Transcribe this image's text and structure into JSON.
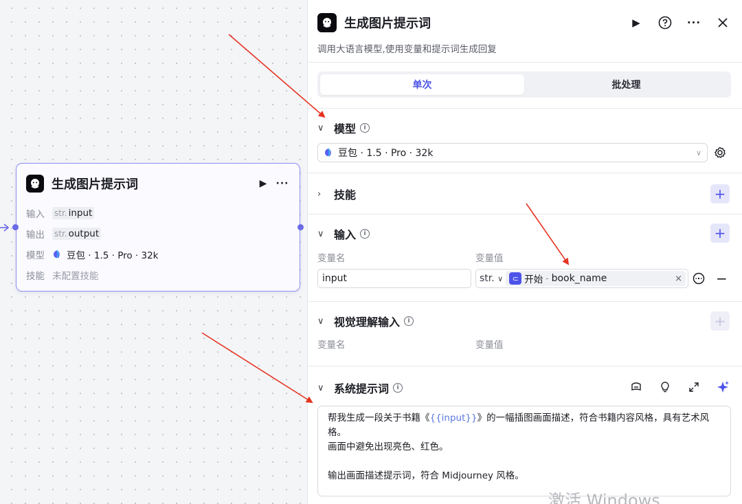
{
  "node": {
    "title": "生成图片提示词",
    "rows": [
      {
        "label": "输入",
        "type": "str.",
        "value": "input"
      },
      {
        "label": "输出",
        "type": "str.",
        "value": "output"
      }
    ],
    "model_label": "模型",
    "model_value": "豆包 · 1.5 · Pro · 32k",
    "skill_label": "技能",
    "skill_value": "未配置技能"
  },
  "panel": {
    "title": "生成图片提示词",
    "description": "调用大语言模型,使用变量和提示词生成回复",
    "tabs": [
      {
        "label": "单次",
        "active": true
      },
      {
        "label": "批处理",
        "active": false
      }
    ],
    "model_section": {
      "title": "模型",
      "selected": "豆包 · 1.5 · Pro · 32k"
    },
    "skills_section": {
      "title": "技能"
    },
    "input_section": {
      "title": "输入",
      "col_name": "变量名",
      "col_value": "变量值",
      "row": {
        "name": "input",
        "type": "str.",
        "ref_source": "开始",
        "ref_sep": "-",
        "ref_var": "book_name"
      }
    },
    "vision_section": {
      "title": "视觉理解输入",
      "col_name": "变量名",
      "col_value": "变量值"
    },
    "prompt_section": {
      "title": "系统提示词",
      "line1_pre": "帮我生成一段关于书籍《",
      "line1_var": "{{input}}",
      "line1_post": "》的一幅插图画面描述，符合书籍内容风格，具有艺术风",
      "line2": "格。",
      "line3": "画面中避免出现亮色、红色。",
      "line4": "输出画面描述提示词，符合 Midjourney 风格。"
    }
  },
  "watermark": "激活 Windows",
  "colors": {
    "accent": "#4d53e8",
    "node_border": "#8f8fef",
    "arrow": "#e53422"
  }
}
